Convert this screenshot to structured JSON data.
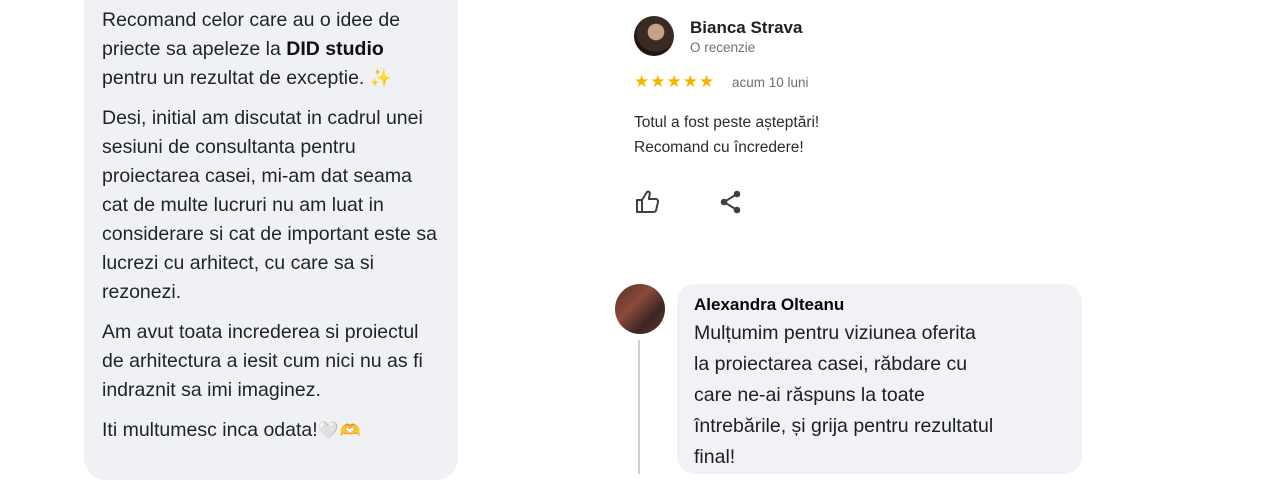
{
  "left_message": {
    "p1": {
      "before": "Recomand celor care au o idee de priecte sa apeleze la ",
      "studio": "DID studio",
      "after": " pentru un rezultat de exceptie.",
      "emoji": "✨"
    },
    "p2": "Desi, initial am discutat in cadrul unei sesiuni de consultanta pentru proiectarea casei, mi-am dat seama cat de multe lucruri nu am luat in considerare si cat de important este sa lucrezi cu arhitect, cu care sa si rezonezi.",
    "p3": "Am avut toata increderea si proiectul de arhitectura a iesit cum nici nu as fi indraznit sa imi imaginez.",
    "p4": {
      "text": "Iti multumesc inca odata!",
      "emoji": "🤍🫶"
    }
  },
  "review": {
    "author": "Bianca Strava",
    "subtitle": "O recenzie",
    "stars": "★★★★★",
    "rating": 5,
    "date": "acum 10 luni",
    "text_lines": [
      "Totul a fost peste așteptări!",
      "Recomand cu încredere!"
    ],
    "icons": {
      "like": "thumbs-up-icon",
      "share": "share-icon"
    },
    "star_color": "#f5b400"
  },
  "comment": {
    "author": "Alexandra Olteanu",
    "text_lines": [
      "Mulțumim pentru viziunea oferita",
      "la proiectarea casei, răbdare cu",
      "care ne-ai răspuns la toate",
      "întrebările, și grija pentru rezultatul",
      "final!"
    ],
    "bubble_color": "#f0f2f5"
  }
}
